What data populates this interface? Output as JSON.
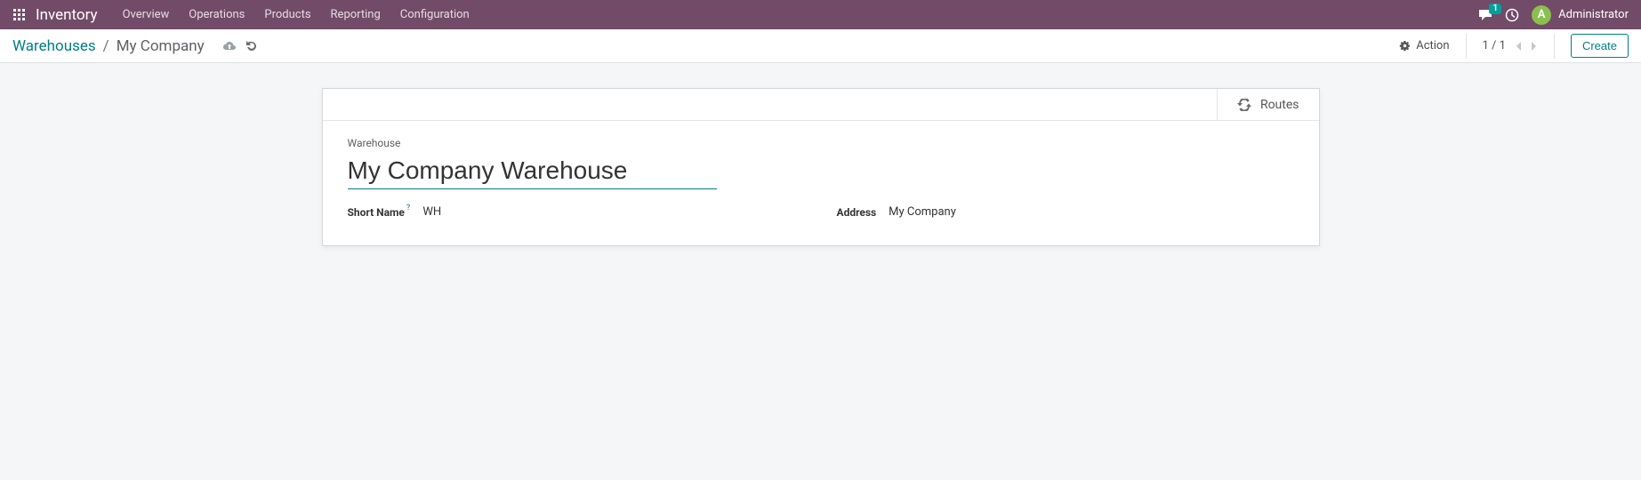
{
  "topbar": {
    "app_title": "Inventory",
    "nav": [
      "Overview",
      "Operations",
      "Products",
      "Reporting",
      "Configuration"
    ],
    "messages_count": "1",
    "user": {
      "initial": "A",
      "name": "Administrator"
    }
  },
  "controlbar": {
    "breadcrumb_root": "Warehouses",
    "breadcrumb_current": "My Company",
    "action_label": "Action",
    "pager": "1 / 1",
    "create_label": "Create"
  },
  "sheet": {
    "routes_label": "Routes",
    "warehouse_label": "Warehouse",
    "warehouse_name": "My Company Warehouse",
    "short_name_label": "Short Name",
    "short_name_value": "WH",
    "help_qm": "?",
    "address_label": "Address",
    "address_value": "My Company"
  }
}
